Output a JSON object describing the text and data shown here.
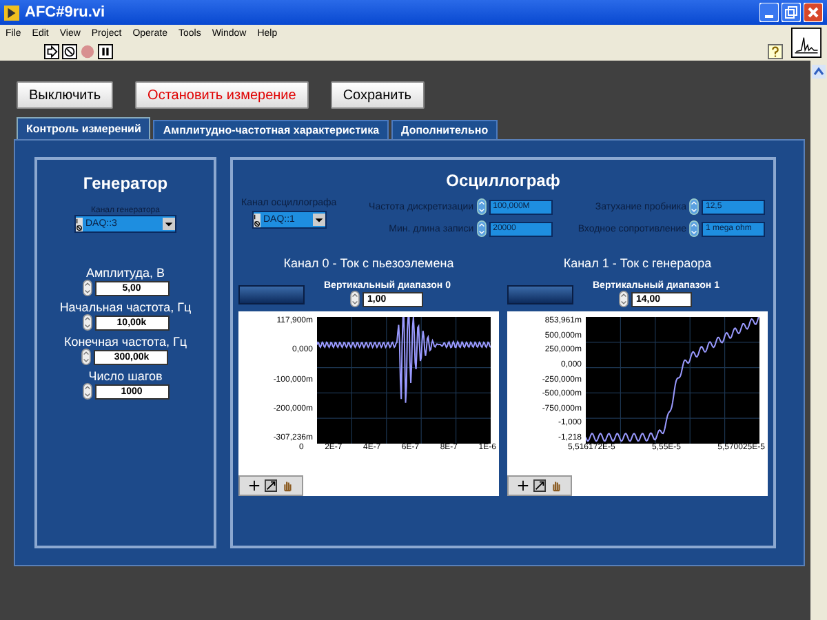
{
  "window": {
    "title": "AFC#9ru.vi"
  },
  "menu": [
    "File",
    "Edit",
    "View",
    "Project",
    "Operate",
    "Tools",
    "Window",
    "Help"
  ],
  "buttons": [
    {
      "label": "Выключить",
      "kind": "normal"
    },
    {
      "label": "Остановить измерение",
      "kind": "warning"
    },
    {
      "label": "Сохранить",
      "kind": "normal"
    }
  ],
  "tabs": [
    {
      "label": "Контроль измерений",
      "selected": true
    },
    {
      "label": "Амплитудно-частотная характеристика",
      "selected": false
    },
    {
      "label": "Дополнительно",
      "selected": false
    }
  ],
  "generator": {
    "title": "Генератор",
    "channel": {
      "label": "Канал генератора",
      "value": "DAQ::3"
    },
    "fields": [
      {
        "label": "Амплитуда, В",
        "value": "5,00"
      },
      {
        "label": "Начальная частота, Гц",
        "value": "10,00k"
      },
      {
        "label": "Конечная частота, Гц",
        "value": "300,00k"
      },
      {
        "label": "Число шагов",
        "value": "1000"
      }
    ]
  },
  "oscilloscope": {
    "title": "Осциллограф",
    "channel": {
      "label": "Канал осциллографа",
      "value": "DAQ::1"
    },
    "settings": [
      {
        "label": "Частота дискретизации",
        "value": "100,000M"
      },
      {
        "label": "Мин. длина записи",
        "value": "20000"
      },
      {
        "label": "Затухание пробника",
        "value": "12,5"
      },
      {
        "label": "Входное сопротивление",
        "value": "1 mega ohm"
      }
    ],
    "channels": [
      {
        "title": "Канал 0 - Ток с пьезоэлемена",
        "range_label": "Вертикальный диапазон 0",
        "range_value": "1,00",
        "kind": "burst",
        "yticks": [
          "117,900m",
          "0,000",
          "-100,000m",
          "-200,000m",
          "-307,236m"
        ],
        "xticks": [
          "0",
          "2E-7",
          "4E-7",
          "6E-7",
          "8E-7",
          "1E-6"
        ]
      },
      {
        "title": "Канал 1 - Ток с генераора",
        "range_label": "Вертикальный диапазон 1",
        "range_value": "14,00",
        "kind": "step",
        "yticks": [
          "853,961m",
          "500,000m",
          "250,000m",
          "0,000",
          "-250,000m",
          "-500,000m",
          "-750,000m",
          "-1,000",
          "-1,218"
        ],
        "xticks": [
          "5,516172E-5",
          "5,55E-5",
          "5,570025E-5"
        ]
      }
    ]
  }
}
